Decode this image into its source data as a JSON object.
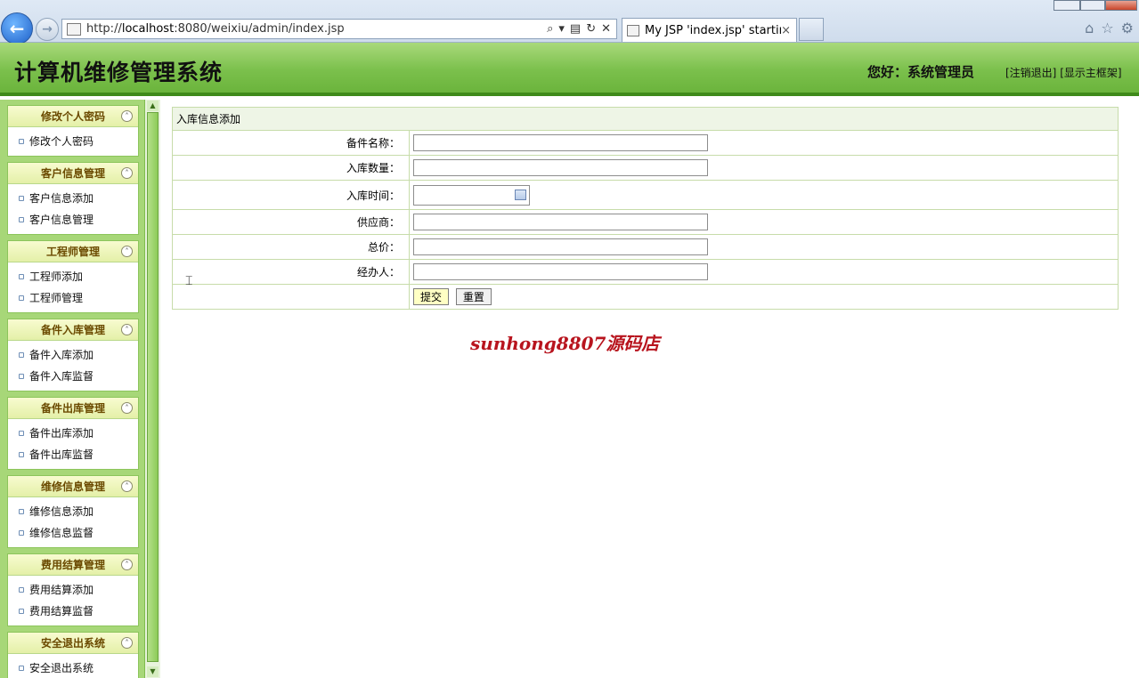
{
  "browser": {
    "url_prefix": "http://",
    "url_host": "localhost",
    "url_rest": ":8080/weixiu/admin/index.jsp",
    "tab_title": "My JSP 'index.jsp' startin...",
    "tab_close": "×",
    "icons": [
      "back-arrow-icon",
      "forward-arrow-icon",
      "search-icon",
      "refresh-icon",
      "stop-icon",
      "home-icon",
      "favorites-star-icon",
      "gear-icon"
    ]
  },
  "header": {
    "title": "计算机维修管理系统",
    "greeting": "您好：系统管理员",
    "logout_link": "[注销退出]",
    "show_frame_link": "[显示主框架]"
  },
  "sidebar": {
    "groups": [
      {
        "title": "修改个人密码",
        "items": [
          "修改个人密码"
        ]
      },
      {
        "title": "客户信息管理",
        "items": [
          "客户信息添加",
          "客户信息管理"
        ]
      },
      {
        "title": "工程师管理",
        "items": [
          "工程师添加",
          "工程师管理"
        ]
      },
      {
        "title": "备件入库管理",
        "items": [
          "备件入库添加",
          "备件入库监督"
        ]
      },
      {
        "title": "备件出库管理",
        "items": [
          "备件出库添加",
          "备件出库监督"
        ]
      },
      {
        "title": "维修信息管理",
        "items": [
          "维修信息添加",
          "维修信息监督"
        ]
      },
      {
        "title": "费用结算管理",
        "items": [
          "费用结算添加",
          "费用结算监督"
        ]
      },
      {
        "title": "安全退出系统",
        "items": [
          "安全退出系统"
        ]
      }
    ]
  },
  "form": {
    "caption": "入库信息添加",
    "fields": {
      "part_name": {
        "label": "备件名称：",
        "value": ""
      },
      "quantity": {
        "label": "入库数量：",
        "value": ""
      },
      "date": {
        "label": "入库时间：",
        "value": ""
      },
      "supplier": {
        "label": "供应商：",
        "value": ""
      },
      "total_price": {
        "label": "总价：",
        "value": ""
      },
      "handler": {
        "label": "经办人：",
        "value": ""
      }
    },
    "submit_label": "提交",
    "reset_label": "重置"
  },
  "watermark": "sunhong8807源码店",
  "colors": {
    "header_green": "#7bc04c",
    "header_border": "#3f8a1a",
    "sidebar_bg": "#a7d778",
    "watermark_red": "#b8141e"
  }
}
